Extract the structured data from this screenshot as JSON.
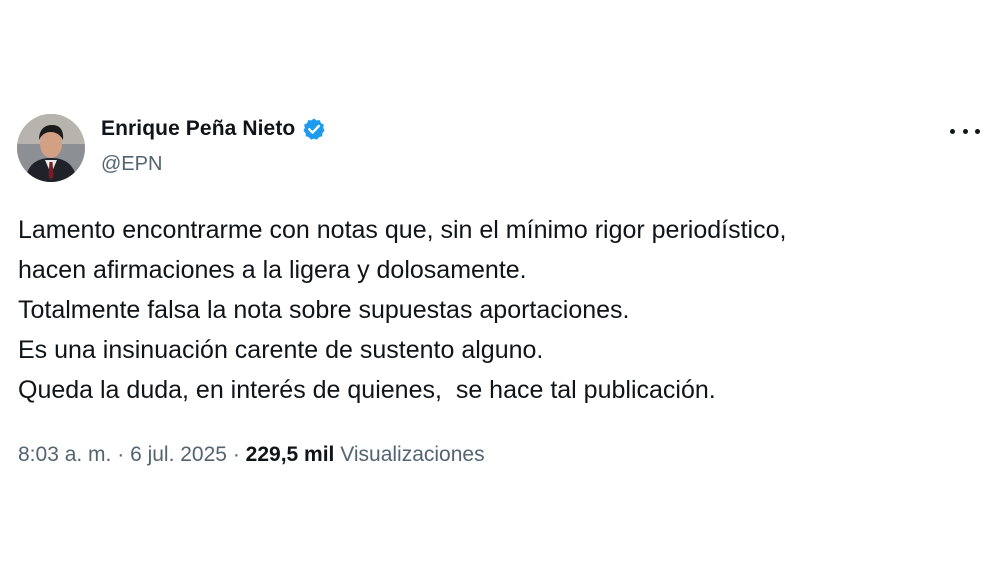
{
  "author": {
    "display_name": "Enrique Peña Nieto",
    "handle": "@EPN",
    "avatar_icon": "profile-photo",
    "verified_icon": "verified-badge-icon",
    "verified_color": "#1d9bf0"
  },
  "tweet": {
    "lines": [
      "Lamento encontrarme con notas que, sin el mínimo rigor periodístico,",
      "hacen afirmaciones a la ligera y dolosamente.",
      "Totalmente falsa la nota sobre supuestas aportaciones.",
      "Es una insinuación carente de sustento alguno.",
      "Queda la duda, en interés de quienes,  se hace tal publicación."
    ]
  },
  "meta": {
    "time": "8:03 a. m.",
    "separator": " · ",
    "date": "6 jul. 2025",
    "views_count": "229,5 mil",
    "views_label": "Visualizaciones"
  },
  "more_icon": "more-options-icon"
}
